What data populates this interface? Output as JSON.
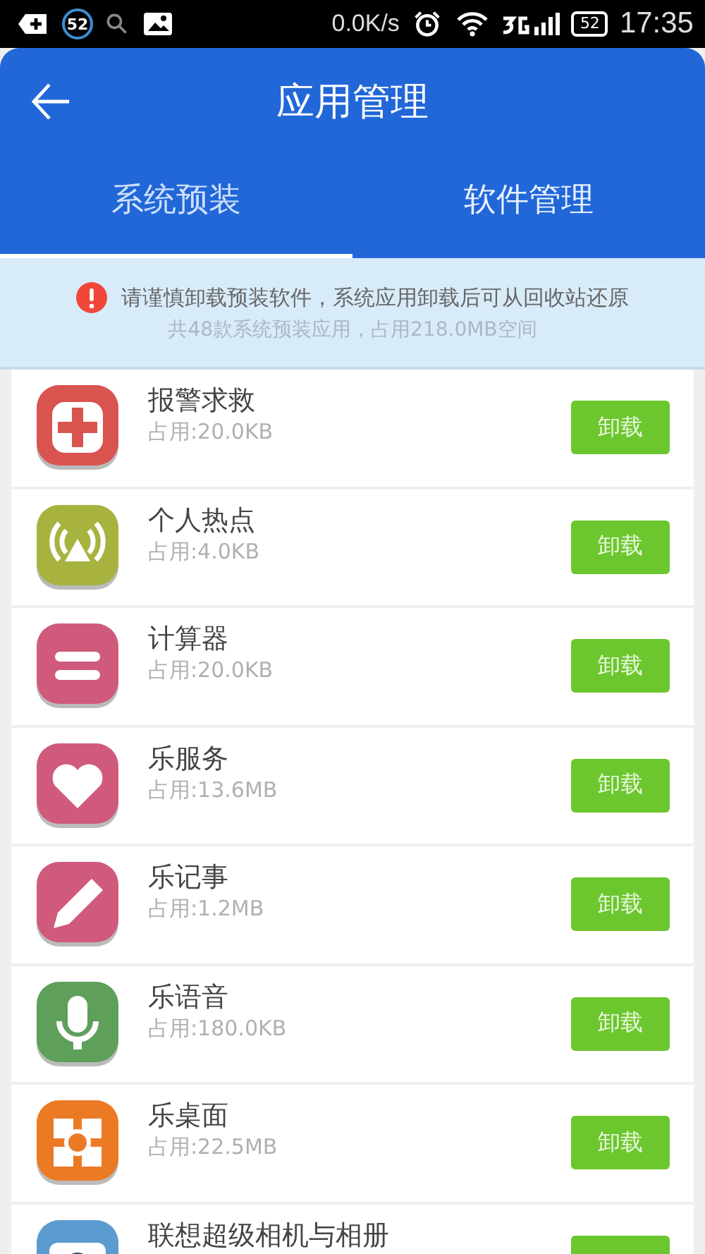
{
  "status_bar": {
    "notification_badge": "52",
    "speed": "0.0K/s",
    "battery": "52",
    "time": "17:35"
  },
  "header": {
    "title": "应用管理"
  },
  "tabs": [
    {
      "label": "系统预装",
      "selected": true
    },
    {
      "label": "软件管理",
      "selected": false
    }
  ],
  "notice": {
    "warning": "请谨慎卸载预装软件，系统应用卸载后可从回收站还原",
    "summary": "共48款系统预装应用，占用218.0MB空间"
  },
  "apps": [
    {
      "name": "报警求救",
      "size": "占用:20.0KB",
      "button": "卸载",
      "color": "#d9534f"
    },
    {
      "name": "个人热点",
      "size": "占用:4.0KB",
      "button": "卸载",
      "color": "#a7b33e"
    },
    {
      "name": "计算器",
      "size": "占用:20.0KB",
      "button": "卸载",
      "color": "#d05a7c"
    },
    {
      "name": "乐服务",
      "size": "占用:13.6MB",
      "button": "卸载",
      "color": "#d05a7c"
    },
    {
      "name": "乐记事",
      "size": "占用:1.2MB",
      "button": "卸载",
      "color": "#d05a7c"
    },
    {
      "name": "乐语音",
      "size": "占用:180.0KB",
      "button": "卸载",
      "color": "#5e9f5a"
    },
    {
      "name": "乐桌面",
      "size": "占用:22.5MB",
      "button": "卸载",
      "color": "#ec7a25"
    },
    {
      "name": "联想超级相机与相册",
      "color": "#5b9bd0"
    }
  ]
}
